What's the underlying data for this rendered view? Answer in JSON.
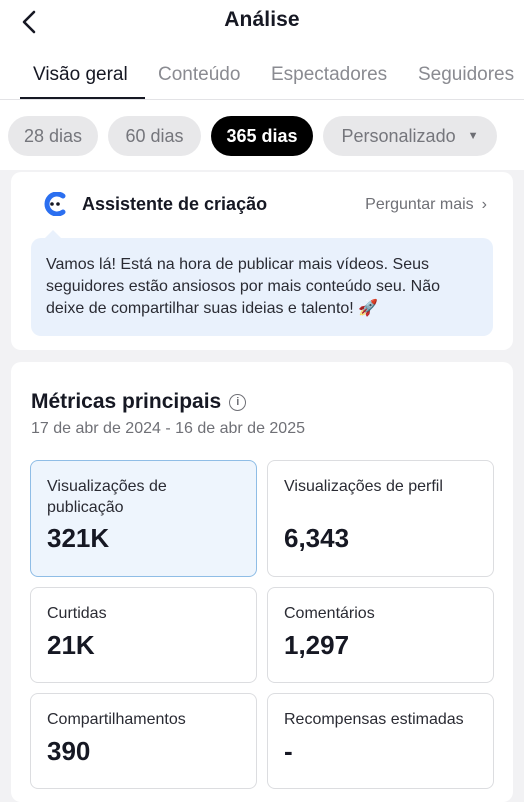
{
  "header": {
    "title": "Análise",
    "back_icon": "chevron-left-icon"
  },
  "tabs": [
    {
      "label": "Visão geral",
      "active": true
    },
    {
      "label": "Conteúdo",
      "active": false
    },
    {
      "label": "Espectadores",
      "active": false
    },
    {
      "label": "Seguidores",
      "active": false
    }
  ],
  "date_filters": [
    {
      "label": "28 dias",
      "active": false
    },
    {
      "label": "60 dias",
      "active": false
    },
    {
      "label": "365 dias",
      "active": true
    },
    {
      "label": "Personalizado",
      "active": false,
      "icon": "caret-down-icon"
    }
  ],
  "assistant": {
    "title": "Assistente de criação",
    "ask_more_label": "Perguntar mais",
    "message": "Vamos lá! Está na hora de publicar mais vídeos. Seus seguidores estão ansiosos por mais conteúdo seu. Não deixe de compartilhar suas ideias e talento! 🚀"
  },
  "metrics": {
    "title": "Métricas principais",
    "date_range": "17 de abr de 2024 - 16 de abr de 2025",
    "items": [
      {
        "label": "Visualizações de publicação",
        "value": "321K",
        "selected": true
      },
      {
        "label": "Visualizações de perfil",
        "value": "6,343",
        "selected": false
      },
      {
        "label": "Curtidas",
        "value": "21K",
        "selected": false
      },
      {
        "label": "Comentários",
        "value": "1,297",
        "selected": false
      },
      {
        "label": "Compartilhamentos",
        "value": "390",
        "selected": false
      },
      {
        "label": "Recompensas estimadas",
        "value": "-",
        "selected": false
      }
    ]
  },
  "colors": {
    "accent_dark": "#000000",
    "assistant_bubble": "#e9f1fc",
    "selected_card": "#eef5fd",
    "selected_border": "#8fbde6",
    "logo_blue": "#2b6ff0"
  }
}
